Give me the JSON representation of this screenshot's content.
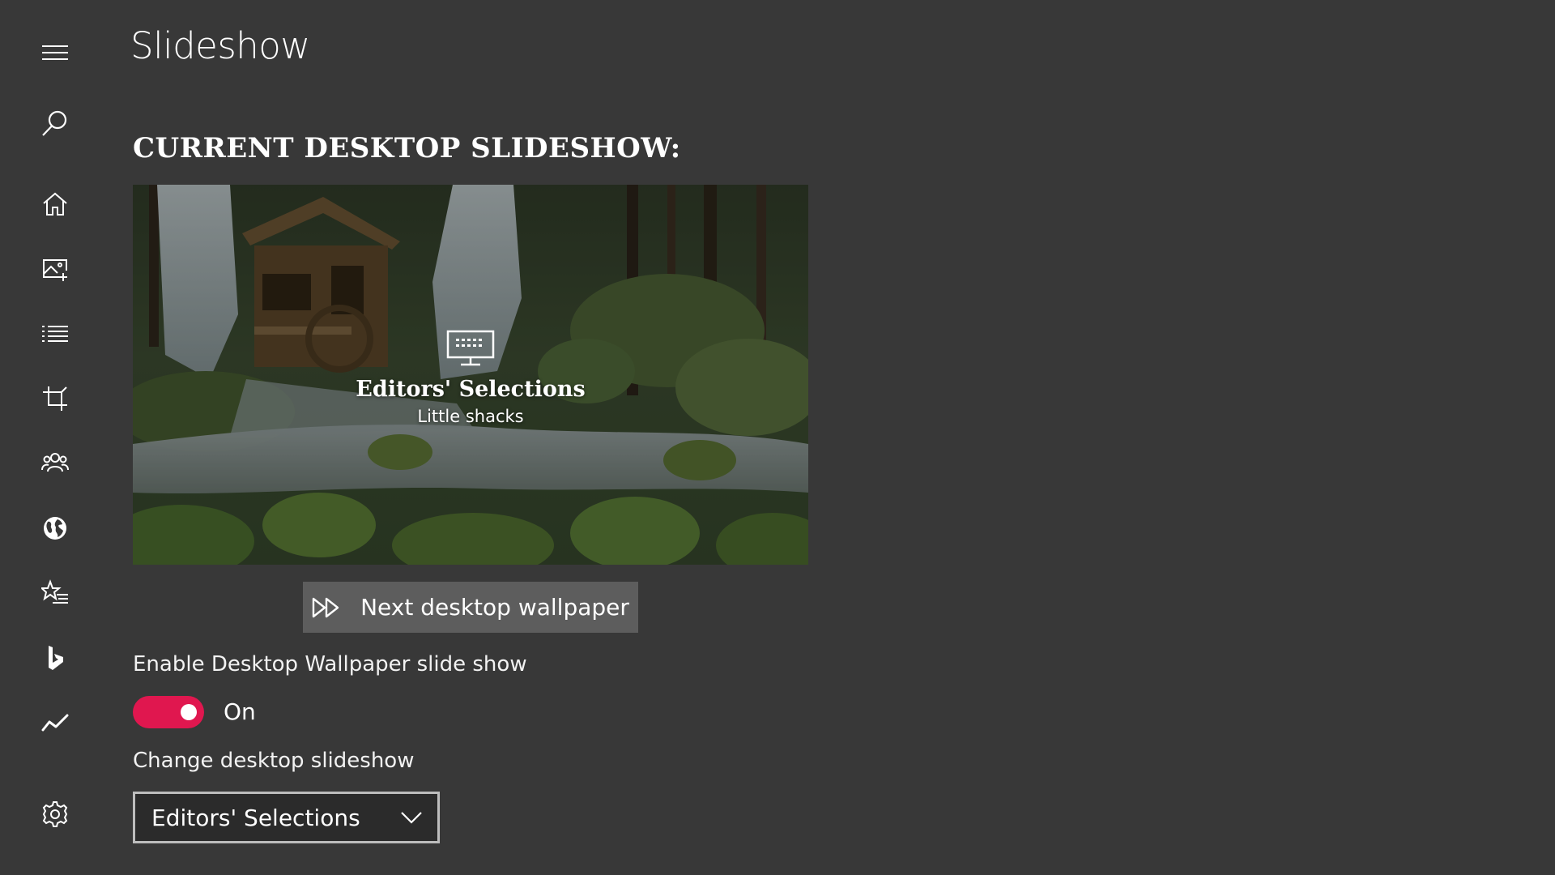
{
  "page": {
    "title": "Slideshow",
    "section_heading": "CURRENT DESKTOP SLIDESHOW:"
  },
  "nav": {
    "items": [
      {
        "name": "menu",
        "icon": "hamburger-menu-icon"
      },
      {
        "name": "search",
        "icon": "search-icon"
      },
      {
        "name": "home",
        "icon": "home-icon"
      },
      {
        "name": "images",
        "icon": "image-add-icon"
      },
      {
        "name": "list",
        "icon": "list-icon"
      },
      {
        "name": "crop",
        "icon": "crop-icon"
      },
      {
        "name": "people",
        "icon": "people-icon"
      },
      {
        "name": "world",
        "icon": "globe-icon"
      },
      {
        "name": "favorites",
        "icon": "star-list-icon"
      },
      {
        "name": "bing",
        "icon": "bing-logo-icon"
      },
      {
        "name": "trends",
        "icon": "trend-chart-icon"
      },
      {
        "name": "settings",
        "icon": "gear-icon"
      }
    ]
  },
  "preview": {
    "collection_name": "Editors' Selections",
    "wallpaper_name": "Little shacks",
    "icon": "desktop-monitor-icon"
  },
  "actions": {
    "next_wallpaper_label": "Next desktop wallpaper",
    "next_wallpaper_icon": "fast-forward-icon"
  },
  "settings": {
    "enable_label": "Enable Desktop Wallpaper slide show",
    "toggle_state": "On",
    "toggle_on": true,
    "change_label": "Change desktop slideshow",
    "dropdown_value": "Editors' Selections"
  },
  "colors": {
    "background": "#383838",
    "accent": "#e0174f",
    "button": "#5d5d5d"
  }
}
